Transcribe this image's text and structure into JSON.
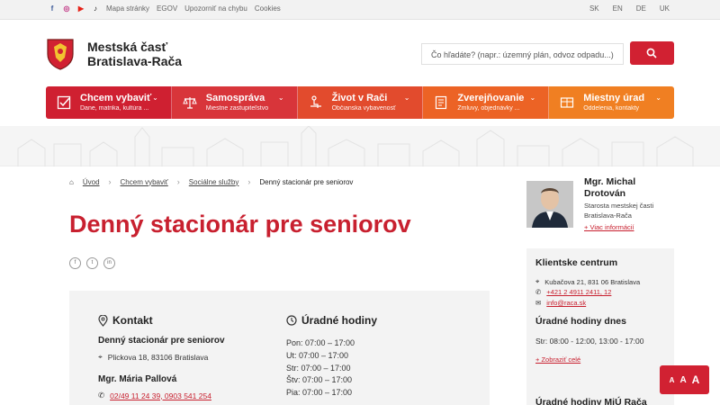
{
  "topbar": {
    "social": [
      "f",
      "◎",
      "▶",
      "♪"
    ],
    "links": [
      "Mapa stránky",
      "EGOV",
      "Upozorniť na chybu",
      "Cookies"
    ],
    "langs": [
      "SK",
      "EN",
      "DE",
      "UK"
    ]
  },
  "header": {
    "logo_line1": "Mestská časť",
    "logo_line2": "Bratislava-Rača",
    "search_placeholder": "Čo hľadáte? (napr.: územný plán, odvoz odpadu...)"
  },
  "nav": [
    {
      "title": "Chcem vybaviť",
      "sub": "Dane, matrika, kultúra ...",
      "color": "#cf2031"
    },
    {
      "title": "Samospráva",
      "sub": "Miestne zastupiteľstvo",
      "color": "#d8353a"
    },
    {
      "title": "Život v Rači",
      "sub": "Občianska vybavenosť",
      "color": "#e24b2d"
    },
    {
      "title": "Zverejňovanie",
      "sub": "Zmluvy, objednávky ...",
      "color": "#ec6325"
    },
    {
      "title": "Miestny úrad",
      "sub": "Oddelenia, kontakty",
      "color": "#f07f22"
    }
  ],
  "breadcrumb": {
    "home": "Úvod",
    "level1": "Chcem vybaviť",
    "level2": "Sociálne služby",
    "current": "Denný stacionár pre seniorov"
  },
  "page_title": "Denný stacionár pre seniorov",
  "share": [
    "f",
    "t",
    "in"
  ],
  "contact": {
    "heading": "Kontakt",
    "org_name": "Denný stacionár pre seniorov",
    "address": "Plickova 18, 83106 Bratislava",
    "person": "Mgr. Mária Pallová",
    "phone": "02/49 11 24 39, 0903 541 254"
  },
  "hours": {
    "heading": "Úradné hodiny",
    "rows": [
      "Pon: 07:00 – 17:00",
      "Ut: 07:00 – 17:00",
      "Str: 07:00 – 17:00",
      "Štv: 07:00 – 17:00",
      "Pia: 07:00 – 17:00"
    ]
  },
  "mayor": {
    "name_line1": "Mgr. Michal",
    "name_line2": "Drotován",
    "role_line1": "Starosta mestskej časti",
    "role_line2": "Bratislava-Rača",
    "more": "+ Viac informácií"
  },
  "client_centre": {
    "heading": "Klientske centrum",
    "address": "Kubačova 21, 831 06 Bratislava",
    "phone": "+421 2 4911 2411, 12",
    "email": "info@raca.sk",
    "hours_heading": "Úradné hodiny dnes",
    "hours_today": "Str: 08:00 - 12:00, 13:00 - 17:00",
    "show_all": "+ Zobraziť celé",
    "bottom_heading": "Úradné hodiny MiÚ Rača"
  },
  "accessibility": {
    "a1": "A",
    "a2": "A",
    "a3": "A"
  },
  "colors": {
    "brand_red": "#c8202f",
    "button_red": "#d12132"
  }
}
